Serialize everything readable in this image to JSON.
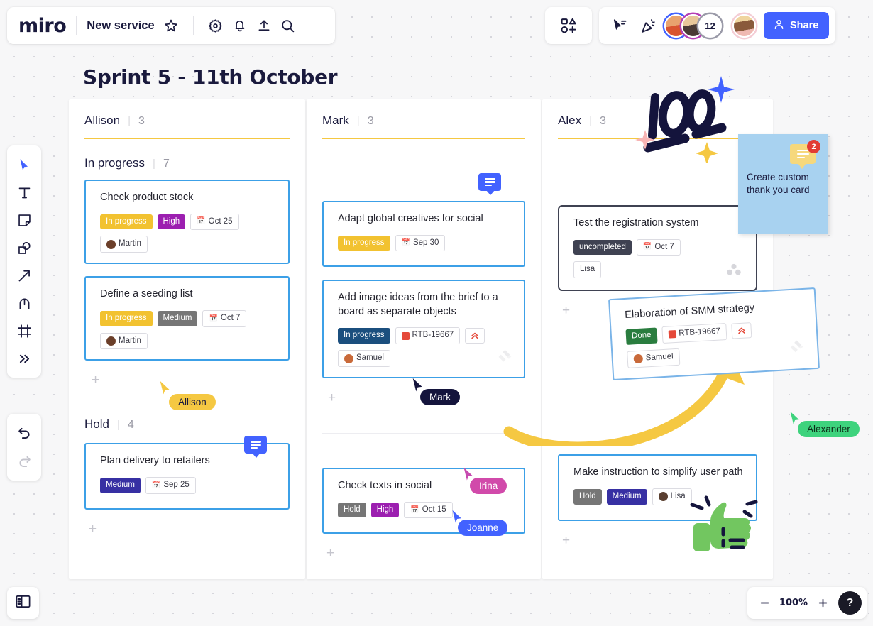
{
  "app": {
    "logo": "miro",
    "board_name": "New service",
    "icons": {
      "favorite": "star-icon",
      "settings": "gear-icon",
      "notifications": "bell-icon",
      "upload": "upload-icon",
      "search": "search-icon",
      "apps": "apps-icon",
      "cursor_share": "cursor-share-icon",
      "celebrate": "celebrate-icon"
    },
    "presence": {
      "extra_count": "12",
      "self_label": ""
    },
    "share_label": "Share"
  },
  "toolbar": {
    "items": [
      {
        "name": "select-tool",
        "icon": "cursor-icon"
      },
      {
        "name": "text-tool",
        "icon": "text-icon"
      },
      {
        "name": "sticky-note-tool",
        "icon": "sticky-note-icon"
      },
      {
        "name": "shapes-tool",
        "icon": "shapes-icon"
      },
      {
        "name": "connector-tool",
        "icon": "arrow-icon"
      },
      {
        "name": "pen-tool",
        "icon": "pen-icon"
      },
      {
        "name": "frame-tool",
        "icon": "frame-icon"
      },
      {
        "name": "more-tools",
        "icon": "chevron-double-right-icon"
      }
    ],
    "undo": "undo-icon",
    "redo": "redo-icon"
  },
  "board": {
    "title": "Sprint 5 - 11th October",
    "add_card_label": "+"
  },
  "columns": [
    {
      "owner": "Allison",
      "separator": "|",
      "count": "3",
      "sections": [
        {
          "label": "In progress",
          "separator": "|",
          "count": "7",
          "cards": [
            {
              "title": "Check product stock",
              "badges": [
                {
                  "text": "In progress",
                  "style": "solid",
                  "color": "#f2c230"
                },
                {
                  "text": "High",
                  "style": "solid",
                  "color": "#9c1fb0"
                },
                {
                  "text": "Oct 25",
                  "style": "outline",
                  "icon": "calendar-icon"
                }
              ],
              "assignees": [
                {
                  "name": "Martin",
                  "color": "#6b3f2a"
                }
              ]
            },
            {
              "title": "Define a seeding list",
              "badges": [
                {
                  "text": "In progress",
                  "style": "solid",
                  "color": "#f2c230"
                },
                {
                  "text": "Medium",
                  "style": "solid",
                  "color": "#767676"
                },
                {
                  "text": "Oct 7",
                  "style": "outline",
                  "icon": "calendar-icon"
                }
              ],
              "assignees": [
                {
                  "name": "Martin",
                  "color": "#6b3f2a"
                }
              ]
            }
          ]
        },
        {
          "label": "Hold",
          "separator": "|",
          "count": "4",
          "cards": [
            {
              "title": "Plan delivery to retailers",
              "comment_badge": true,
              "badges": [
                {
                  "text": "Medium",
                  "style": "solid",
                  "color": "#3730a3"
                },
                {
                  "text": "Sep 25",
                  "style": "outline",
                  "icon": "calendar-icon"
                }
              ],
              "assignees": []
            }
          ]
        }
      ]
    },
    {
      "owner": "Mark",
      "separator": "|",
      "count": "3",
      "sections": [
        {
          "label": "",
          "separator": "",
          "count": "",
          "cards": [
            {
              "title": "Adapt global creatives for social",
              "comment_badge": true,
              "badges": [
                {
                  "text": "In progress",
                  "style": "solid",
                  "color": "#f2c230"
                },
                {
                  "text": "Sep 30",
                  "style": "outline",
                  "icon": "calendar-icon"
                }
              ],
              "assignees": []
            },
            {
              "title": "Add image ideas from the brief to a board as separate objects",
              "jira": true,
              "badges": [
                {
                  "text": "In progress",
                  "style": "solid",
                  "color": "#1b4f7e"
                },
                {
                  "text": "RTB-19667",
                  "style": "outline",
                  "icon": "jira-task-icon"
                },
                {
                  "text": "",
                  "style": "outline",
                  "icon": "priority-high-icon"
                }
              ],
              "assignees": [
                {
                  "name": "Samuel",
                  "color": "#c96a3a"
                }
              ]
            }
          ]
        },
        {
          "label": "",
          "separator": "",
          "count": "",
          "cards": [
            {
              "title": "Check texts in social",
              "badges": [
                {
                  "text": "Hold",
                  "style": "solid",
                  "color": "#767676"
                },
                {
                  "text": "High",
                  "style": "solid",
                  "color": "#9c1fb0"
                },
                {
                  "text": "Oct 15",
                  "style": "outline",
                  "icon": "calendar-icon"
                }
              ],
              "assignees": []
            }
          ]
        }
      ]
    },
    {
      "owner": "Alex",
      "separator": "|",
      "count": "3",
      "sections": [
        {
          "label": "",
          "separator": "",
          "count": "",
          "cards": [
            {
              "title": "Test the registration system",
              "selected": true,
              "avatar_stack": true,
              "badges": [
                {
                  "text": "uncompleted",
                  "style": "solid",
                  "color": "#3f4252"
                },
                {
                  "text": "Oct 7",
                  "style": "outline",
                  "icon": "calendar-icon"
                }
              ],
              "assignees": [
                {
                  "name": "Lisa",
                  "color": ""
                }
              ]
            }
          ]
        },
        {
          "label": "",
          "separator": "",
          "count": "",
          "cards": [
            {
              "title": "Make instruction to simplify user path",
              "badges": [
                {
                  "text": "Hold",
                  "style": "solid",
                  "color": "#767676"
                },
                {
                  "text": "Medium",
                  "style": "solid",
                  "color": "#3730a3"
                },
                {
                  "text": "Lisa",
                  "style": "outline",
                  "icon": "avatar-icon"
                }
              ],
              "assignees": []
            }
          ]
        }
      ]
    }
  ],
  "floating_card": {
    "title": "Elaboration of SMM strategy",
    "badges": [
      {
        "text": "Done",
        "style": "solid",
        "color": "#2a7d3f"
      },
      {
        "text": "RTB-19667",
        "style": "outline",
        "icon": "jira-task-icon"
      },
      {
        "text": "",
        "style": "outline",
        "icon": "priority-high-icon"
      }
    ],
    "assignee": "Samuel"
  },
  "sticky_note": {
    "text": "Create custom thank you card",
    "color": "#a8d2f0",
    "comment_count": "2"
  },
  "cursors": [
    {
      "name": "Allison",
      "color": "#f5c842",
      "text_color": "#1a1a3d"
    },
    {
      "name": "Mark",
      "color": "#1a1a3d",
      "text_color": "#ffffff"
    },
    {
      "name": "Irina",
      "color": "#d14aaa",
      "text_color": "#ffffff"
    },
    {
      "name": "Joanne",
      "color": "#4262ff",
      "text_color": "#ffffff"
    },
    {
      "name": "Alexander",
      "color": "#3ed37d",
      "text_color": "#0d2b18"
    }
  ],
  "doodles": {
    "hundred": "100",
    "arrow": "yellow-curved-arrow",
    "thumbs_up": "green-thumbs-up"
  },
  "bottom": {
    "panel_toggle": "panel-toggle-icon",
    "zoom_out": "−",
    "zoom_level": "100%",
    "zoom_in": "+",
    "help": "?"
  }
}
